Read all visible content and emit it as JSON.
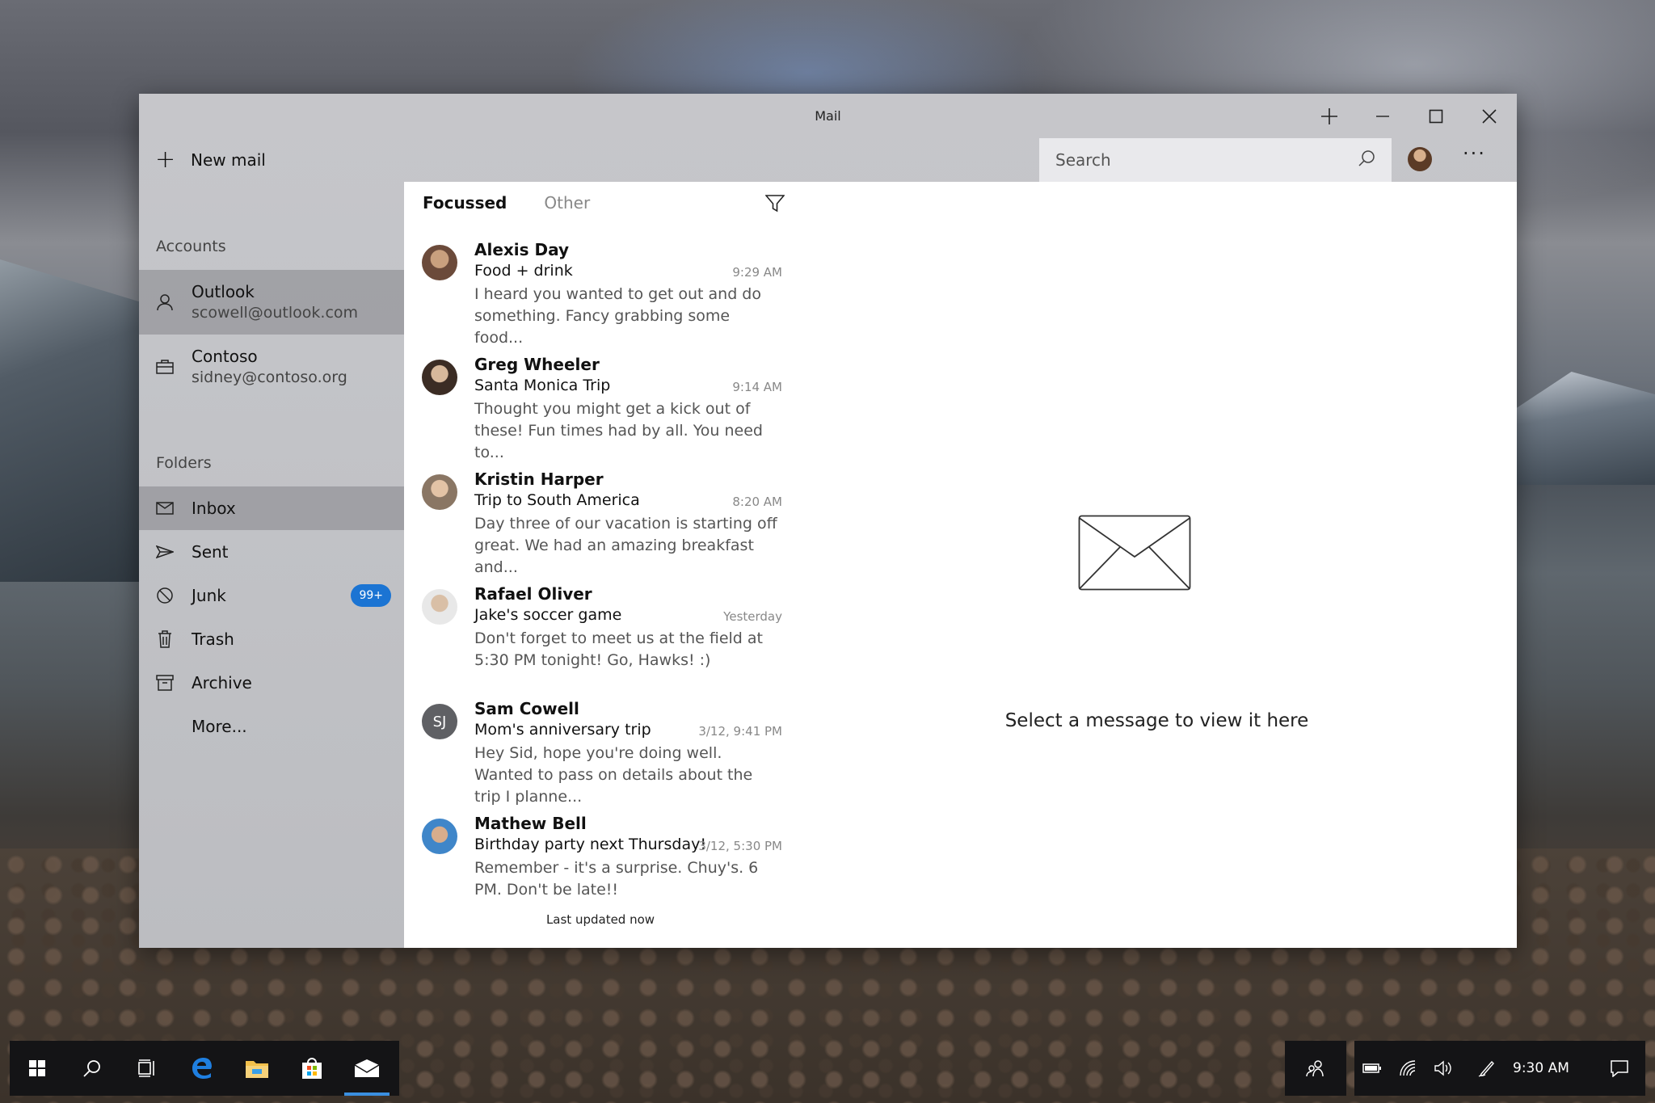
{
  "window": {
    "title": "Mail"
  },
  "nav": {
    "new_mail_label": "New mail",
    "accounts_label": "Accounts",
    "accounts": [
      {
        "name": "Outlook",
        "email": "scowell@outlook.com",
        "icon": "person-icon",
        "selected": true
      },
      {
        "name": "Contoso",
        "email": "sidney@contoso.org",
        "icon": "briefcase-icon",
        "selected": false
      }
    ],
    "folders_label": "Folders",
    "folders": [
      {
        "label": "Inbox",
        "icon": "inbox-icon",
        "selected": true
      },
      {
        "label": "Sent",
        "icon": "send-icon"
      },
      {
        "label": "Junk",
        "icon": "block-icon",
        "badge": "99+"
      },
      {
        "label": "Trash",
        "icon": "trash-icon"
      },
      {
        "label": "Archive",
        "icon": "archive-icon"
      },
      {
        "label": "More..."
      }
    ]
  },
  "search": {
    "placeholder": "Search"
  },
  "pivots": {
    "focused": "Focussed",
    "other": "Other"
  },
  "messages": [
    {
      "from": "Alexis Day",
      "subject": "Food + drink",
      "time": "9:29 AM",
      "preview": "I heard you wanted to get out and do something. Fancy grabbing some food..."
    },
    {
      "from": "Greg Wheeler",
      "subject": "Santa Monica Trip",
      "time": "9:14 AM",
      "preview": "Thought you might get a kick out of these! Fun times had by all. You need to..."
    },
    {
      "from": "Kristin Harper",
      "subject": "Trip to South America",
      "time": "8:20 AM",
      "preview": "Day three of our vacation is starting off great. We had an amazing breakfast and..."
    },
    {
      "from": "Rafael Oliver",
      "subject": "Jake's soccer game",
      "time": "Yesterday",
      "preview": "Don't forget to meet us at the field at 5:30 PM tonight! Go, Hawks! :)"
    },
    {
      "from": "Sam Cowell",
      "initials": "SJ",
      "subject": "Mom's anniversary trip",
      "time": "3/12, 9:41 PM",
      "preview": "Hey Sid, hope you're doing well. Wanted to pass on details about the trip I planne..."
    },
    {
      "from": "Mathew Bell",
      "subject": "Birthday party next Thursday!",
      "time": "3/12, 5:30 PM",
      "preview": "Remember - it's a surprise. Chuy's. 6 PM. Don't be late!!"
    }
  ],
  "status": {
    "updated": "Last updated now"
  },
  "reading_pane": {
    "empty_text": "Select a message to view it here"
  },
  "taskbar": {
    "apps": [
      "windows-start-icon",
      "search-icon",
      "task-view-icon",
      "edge-icon",
      "file-explorer-icon",
      "store-icon",
      "mail-icon"
    ],
    "clock": "9:30 AM"
  },
  "colors": {
    "accent": "#1b74d3",
    "badge_bg": "#1b74d3",
    "selected_bg": "#8f8f93"
  }
}
